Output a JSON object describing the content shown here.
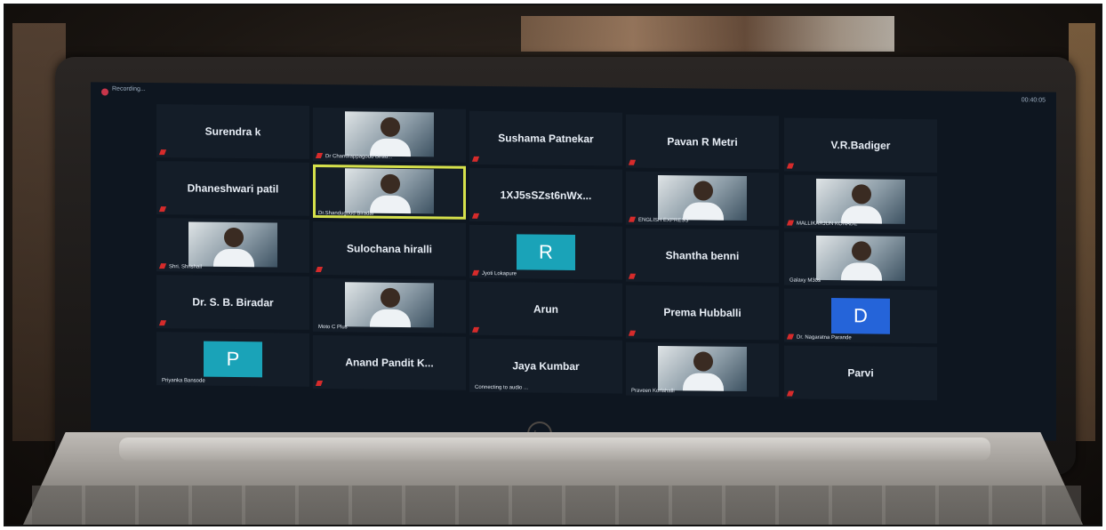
{
  "meeting": {
    "recording_label": "Recording...",
    "clock": "00:40:05"
  },
  "brand": {
    "logo": "hp"
  },
  "tiles": [
    {
      "name": "Surendra k",
      "label": "",
      "mic_muted": true,
      "video": false,
      "avatar": ""
    },
    {
      "name": "",
      "label": "Dr Chandrappagoud Birad...",
      "mic_muted": true,
      "video": true,
      "avatar": ""
    },
    {
      "name": "Sushama Patnekar",
      "label": "",
      "mic_muted": true,
      "video": false,
      "avatar": ""
    },
    {
      "name": "Pavan R Metri",
      "label": "",
      "mic_muted": true,
      "video": false,
      "avatar": ""
    },
    {
      "name": "V.R.Badiger",
      "label": "",
      "mic_muted": true,
      "video": false,
      "avatar": ""
    },
    {
      "name": "Dhaneshwari patil",
      "label": "",
      "mic_muted": true,
      "video": false,
      "avatar": ""
    },
    {
      "name": "",
      "label": "Dr.Shandugoud Biradar",
      "mic_muted": false,
      "video": true,
      "avatar": "",
      "active": true
    },
    {
      "name": "1XJ5sSZst6nWx...",
      "label": "",
      "mic_muted": true,
      "video": false,
      "avatar": ""
    },
    {
      "name": "",
      "label": "ENGLISH EXPRESS",
      "mic_muted": true,
      "video": true,
      "avatar": ""
    },
    {
      "name": "",
      "label": "MALLIKARJUN KONADE",
      "mic_muted": true,
      "video": true,
      "avatar": ""
    },
    {
      "name": "",
      "label": "Shri. Shrishail",
      "mic_muted": true,
      "video": true,
      "avatar": ""
    },
    {
      "name": "Sulochana hiralli",
      "label": "",
      "mic_muted": true,
      "video": false,
      "avatar": ""
    },
    {
      "name": "",
      "label": "Jyoti Lokapure",
      "mic_muted": true,
      "video": false,
      "avatar": "R",
      "avatar_color": "#1aa3b8"
    },
    {
      "name": "Shantha benni",
      "label": "",
      "mic_muted": true,
      "video": false,
      "avatar": ""
    },
    {
      "name": "",
      "label": "Galaxy M30s",
      "mic_muted": false,
      "video": true,
      "avatar": ""
    },
    {
      "name": "Dr. S. B. Biradar",
      "label": "",
      "mic_muted": true,
      "video": false,
      "avatar": ""
    },
    {
      "name": "",
      "label": "Moto C Plus",
      "mic_muted": false,
      "video": true,
      "avatar": ""
    },
    {
      "name": "Arun",
      "label": "",
      "mic_muted": true,
      "video": false,
      "avatar": ""
    },
    {
      "name": "Prema Hubballi",
      "label": "",
      "mic_muted": true,
      "video": false,
      "avatar": ""
    },
    {
      "name": "",
      "label": "Dr. Nagaratna Parande",
      "mic_muted": true,
      "video": false,
      "avatar": "D",
      "avatar_color": "#2564d9"
    },
    {
      "name": "",
      "label": "Priyanka Bansode",
      "mic_muted": false,
      "video": false,
      "avatar": "P",
      "avatar_color": "#1aa3b8"
    },
    {
      "name": "Anand Pandit K...",
      "label": "",
      "mic_muted": true,
      "video": false,
      "avatar": ""
    },
    {
      "name": "Jaya Kumbar",
      "label": "Connecting to audio ...",
      "mic_muted": false,
      "video": false,
      "avatar": ""
    },
    {
      "name": "",
      "label": "Praveen Korlahalli",
      "mic_muted": false,
      "video": true,
      "avatar": ""
    },
    {
      "name": "Parvi",
      "label": "",
      "mic_muted": true,
      "video": false,
      "avatar": ""
    }
  ]
}
